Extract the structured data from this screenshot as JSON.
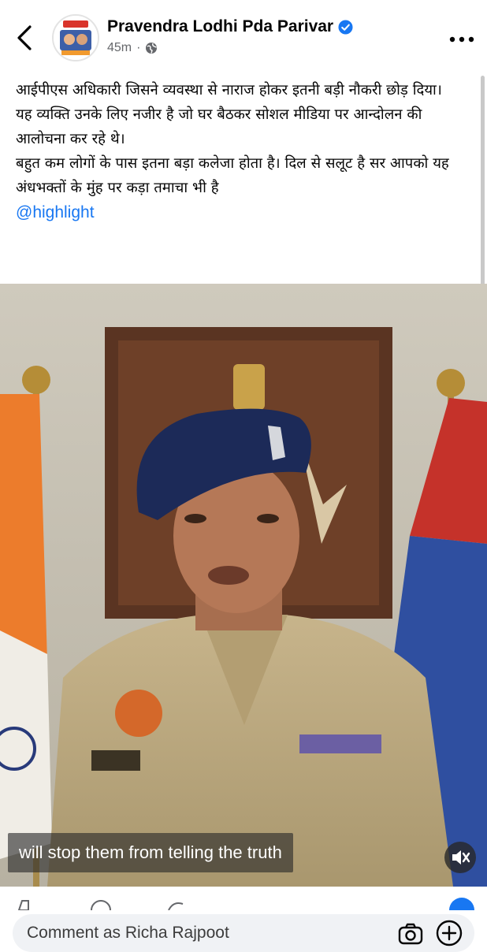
{
  "header": {
    "back_icon": "chevron-left-icon",
    "page_name": "Pravendra Lodhi Pda Parivar",
    "verified_icon": "verified-badge-icon",
    "timestamp": "45m",
    "audience_icon": "globe-icon",
    "more_icon": "more-horizontal-icon"
  },
  "post": {
    "lines": [
      "आईपीएस अधिकारी जिसने व्यवस्था से नाराज होकर इतनी बड़ी नौकरी छोड़ दिया।",
      "यह व्यक्ति उनके लिए नजीर है जो घर बैठकर सोशल मीडिया पर आन्दोलन की आलोचना कर रहे थे।",
      "बहुत कम लोगों के पास इतना बड़ा कलेजा होता है। दिल से सलूट है सर आपको यह अंधभक्तों के मुंह पर कड़ा तमाचा भी है"
    ],
    "hashtag": "@highlight"
  },
  "video": {
    "subtitle": "will stop them from telling the truth",
    "mute_icon": "speaker-muted-icon"
  },
  "comment_bar": {
    "placeholder": "Comment as Richa Rajpoot",
    "camera_icon": "camera-icon",
    "add_icon": "plus-circle-icon"
  },
  "colors": {
    "link": "#1877f2",
    "verified": "#1877f2",
    "secondary_text": "#65676b",
    "comment_bg": "#f0f2f5"
  }
}
